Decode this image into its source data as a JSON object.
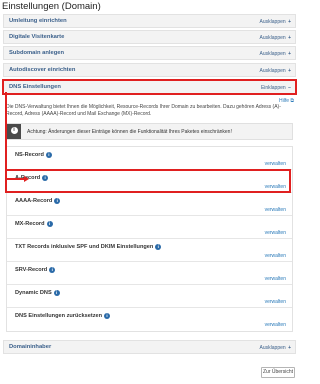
{
  "page": {
    "title": "Einstellungen (Domain)"
  },
  "sections": [
    {
      "label": "Umleitung einrichten",
      "toggle": "Ausklappen",
      "symbol": "+"
    },
    {
      "label": "Digitale Visitenkarte",
      "toggle": "Ausklappen",
      "symbol": "+"
    },
    {
      "label": "Subdomain anlegen",
      "toggle": "Ausklappen",
      "symbol": "+"
    },
    {
      "label": "Autodiscover einrichten",
      "toggle": "Ausklappen",
      "symbol": "+"
    },
    {
      "label": "DNS Einstellungen",
      "toggle": "Einklappen",
      "symbol": "−"
    }
  ],
  "dns": {
    "help": "Hilfe",
    "description": "Die DNS-Verwaltung bietet Ihnen die Möglichkeit, Resource-Records Ihrer Domain zu bearbeiten. Dazu gehören Adress (A)-Record, Adress (AAAA)-Record und Mail Exchange (MX)-Record.",
    "warning": "Achtung: Änderungen dieser Einträge können die Funktionalität Ihres Paketes einschränken!",
    "manage_label": "verwalten",
    "records": [
      {
        "label": "NS-Record"
      },
      {
        "label": "A-Record"
      },
      {
        "label": "AAAA-Record"
      },
      {
        "label": "MX-Record"
      },
      {
        "label": "TXT Records inklusive SPF und DKIM Einstellungen"
      },
      {
        "label": "SRV-Record"
      },
      {
        "label": "Dynamic DNS"
      },
      {
        "label": "DNS Einstellungen zurücksetzen"
      }
    ]
  },
  "owner_section": {
    "label": "Domaininhaber",
    "toggle": "Ausklappen",
    "symbol": "+"
  },
  "footer": {
    "overview_button": "Zur Übersicht"
  },
  "colors": {
    "highlight": "#e02020",
    "link": "#2a7ab9",
    "section_label": "#3a5f8a",
    "info_icon": "#2a6aa8"
  }
}
